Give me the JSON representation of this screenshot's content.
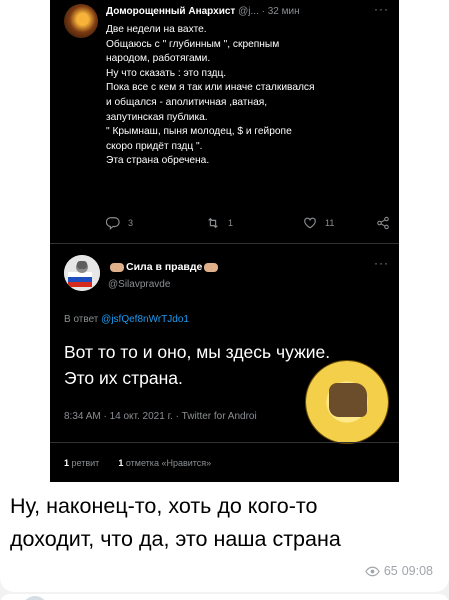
{
  "tweet1": {
    "author_name": "Доморощенный Анархист",
    "handle": "@j...",
    "time": "· 32 мин",
    "more": "···",
    "lines": [
      "Две недели на вахте.",
      "Общаюсь с \" глубинным \", скрепным",
      "народом, работягами.",
      "Ну что сказать : это пздц.",
      "Пока все с кем я так или иначе сталкивался",
      "и общался - аполитичная ,ватная,",
      "запутинская публика.",
      "\" Крымнаш, пыня молодец, $ и гейропе",
      "скоро придёт пздц \".",
      "Эта страна обречена."
    ],
    "replies": "3",
    "retweets": "1",
    "likes": "11"
  },
  "tweet2": {
    "author_name": "Сила в правде",
    "handle": "@Silavpravde",
    "more": "···",
    "reply_prefix": "В ответ",
    "reply_handle": "@jsfQef8nWrTJdo1",
    "lines": [
      "Вот то то и оно, мы здесь чужие.",
      "Это их страна."
    ],
    "meta": "8:34 AM · 14 окт. 2021 г. · Twitter for Androi",
    "retweet_count": "1",
    "retweet_label": "ретвит",
    "like_count": "1",
    "like_label": "отметка «Нравится»"
  },
  "caption_lines": [
    "Ну, наконец-то, хоть до кого-то",
    "доходит, что да, это наша страна"
  ],
  "message": {
    "views": "65",
    "time": "09:08"
  }
}
